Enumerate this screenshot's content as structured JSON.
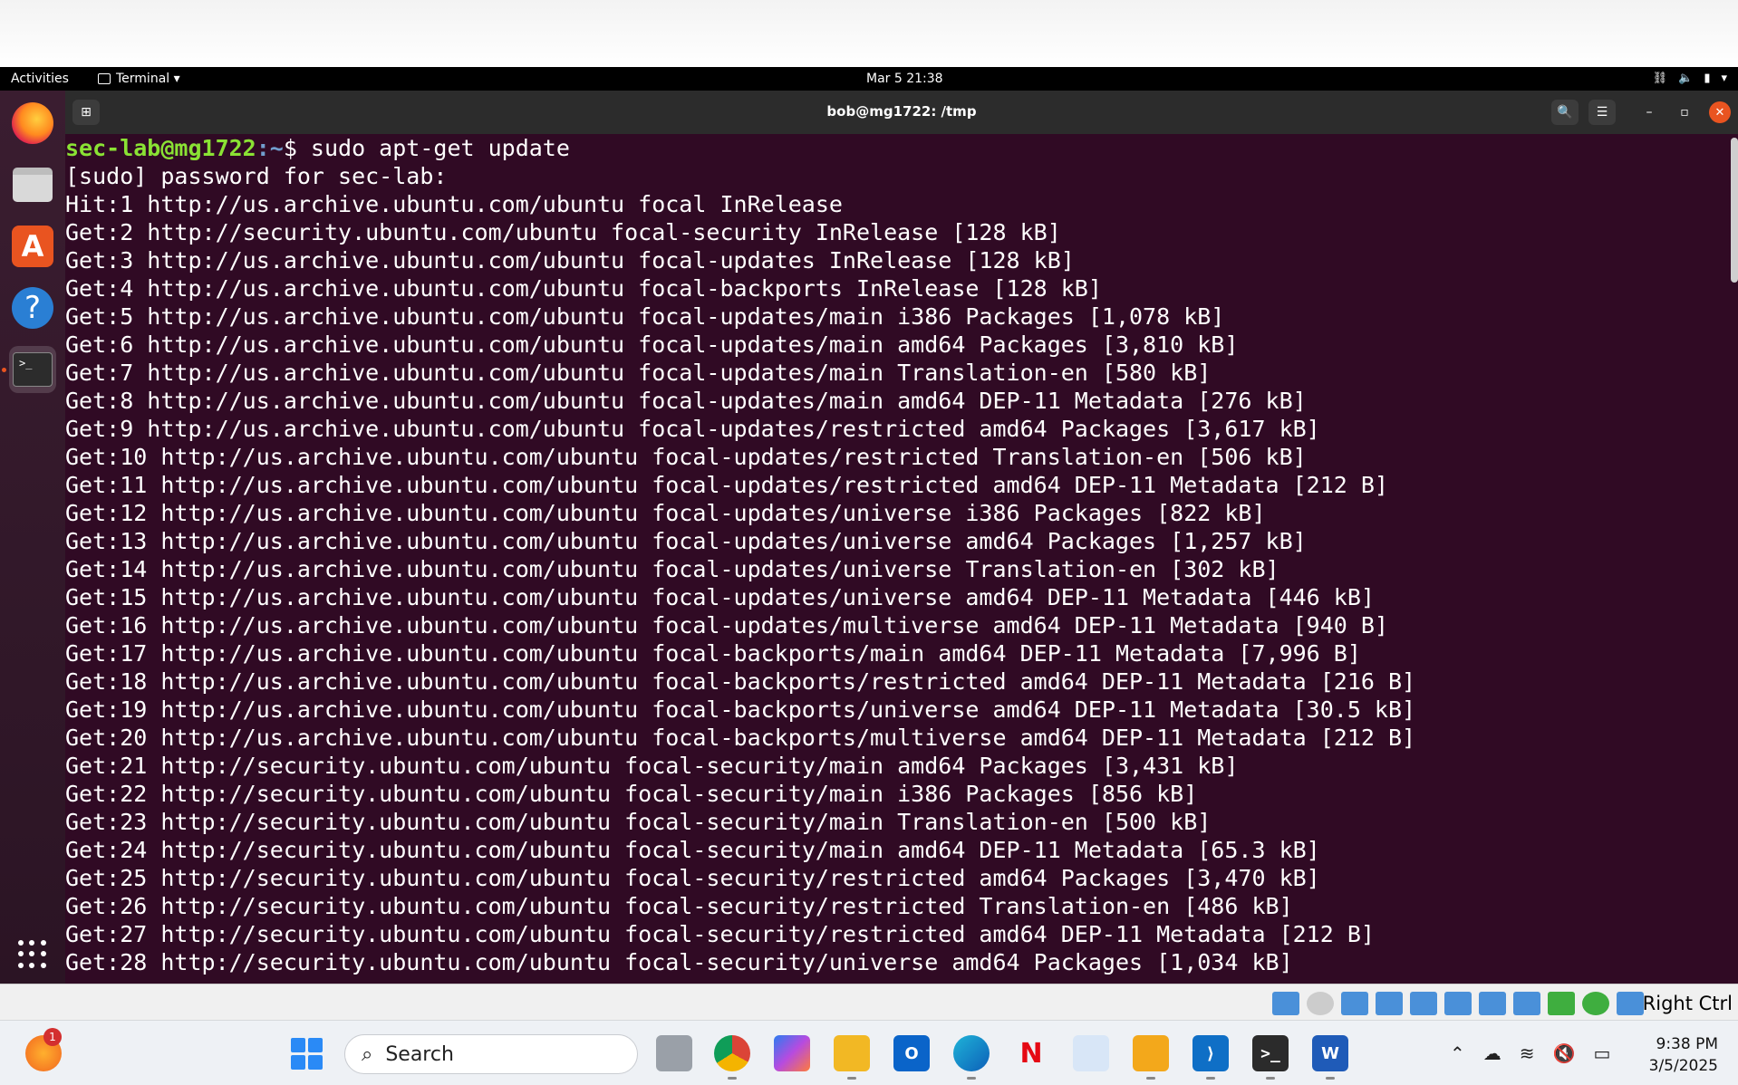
{
  "gnome": {
    "activities": "Activities",
    "app_menu": "Terminal ▾",
    "clock": "Mar 5  21:38"
  },
  "terminal": {
    "title": "bob@mg1722: /tmp",
    "prompt_user": "sec-lab@mg1722",
    "prompt_path": ":~",
    "command": "$ sudo apt-get update",
    "lines": [
      "[sudo] password for sec-lab:",
      "Hit:1 http://us.archive.ubuntu.com/ubuntu focal InRelease",
      "Get:2 http://security.ubuntu.com/ubuntu focal-security InRelease [128 kB]",
      "Get:3 http://us.archive.ubuntu.com/ubuntu focal-updates InRelease [128 kB]",
      "Get:4 http://us.archive.ubuntu.com/ubuntu focal-backports InRelease [128 kB]",
      "Get:5 http://us.archive.ubuntu.com/ubuntu focal-updates/main i386 Packages [1,078 kB]",
      "Get:6 http://us.archive.ubuntu.com/ubuntu focal-updates/main amd64 Packages [3,810 kB]",
      "Get:7 http://us.archive.ubuntu.com/ubuntu focal-updates/main Translation-en [580 kB]",
      "Get:8 http://us.archive.ubuntu.com/ubuntu focal-updates/main amd64 DEP-11 Metadata [276 kB]",
      "Get:9 http://us.archive.ubuntu.com/ubuntu focal-updates/restricted amd64 Packages [3,617 kB]",
      "Get:10 http://us.archive.ubuntu.com/ubuntu focal-updates/restricted Translation-en [506 kB]",
      "Get:11 http://us.archive.ubuntu.com/ubuntu focal-updates/restricted amd64 DEP-11 Metadata [212 B]",
      "Get:12 http://us.archive.ubuntu.com/ubuntu focal-updates/universe i386 Packages [822 kB]",
      "Get:13 http://us.archive.ubuntu.com/ubuntu focal-updates/universe amd64 Packages [1,257 kB]",
      "Get:14 http://us.archive.ubuntu.com/ubuntu focal-updates/universe Translation-en [302 kB]",
      "Get:15 http://us.archive.ubuntu.com/ubuntu focal-updates/universe amd64 DEP-11 Metadata [446 kB]",
      "Get:16 http://us.archive.ubuntu.com/ubuntu focal-updates/multiverse amd64 DEP-11 Metadata [940 B]",
      "Get:17 http://us.archive.ubuntu.com/ubuntu focal-backports/main amd64 DEP-11 Metadata [7,996 B]",
      "Get:18 http://us.archive.ubuntu.com/ubuntu focal-backports/restricted amd64 DEP-11 Metadata [216 B]",
      "Get:19 http://us.archive.ubuntu.com/ubuntu focal-backports/universe amd64 DEP-11 Metadata [30.5 kB]",
      "Get:20 http://us.archive.ubuntu.com/ubuntu focal-backports/multiverse amd64 DEP-11 Metadata [212 B]",
      "Get:21 http://security.ubuntu.com/ubuntu focal-security/main amd64 Packages [3,431 kB]",
      "Get:22 http://security.ubuntu.com/ubuntu focal-security/main i386 Packages [856 kB]",
      "Get:23 http://security.ubuntu.com/ubuntu focal-security/main Translation-en [500 kB]",
      "Get:24 http://security.ubuntu.com/ubuntu focal-security/main amd64 DEP-11 Metadata [65.3 kB]",
      "Get:25 http://security.ubuntu.com/ubuntu focal-security/restricted amd64 Packages [3,470 kB]",
      "Get:26 http://security.ubuntu.com/ubuntu focal-security/restricted Translation-en [486 kB]",
      "Get:27 http://security.ubuntu.com/ubuntu focal-security/restricted amd64 DEP-11 Metadata [212 B]",
      "Get:28 http://security.ubuntu.com/ubuntu focal-security/universe amd64 Packages [1,034 kB]"
    ]
  },
  "vbox": {
    "host_key": "Right Ctrl"
  },
  "taskbar": {
    "search_label": "Search",
    "notification_count": "1",
    "time": "9:38 PM",
    "date": "3/5/2025"
  },
  "colors": {
    "terminal_bg": "#300a24",
    "prompt_user": "#8ae234",
    "prompt_path": "#729fcf",
    "ubuntu_orange": "#e95420"
  }
}
